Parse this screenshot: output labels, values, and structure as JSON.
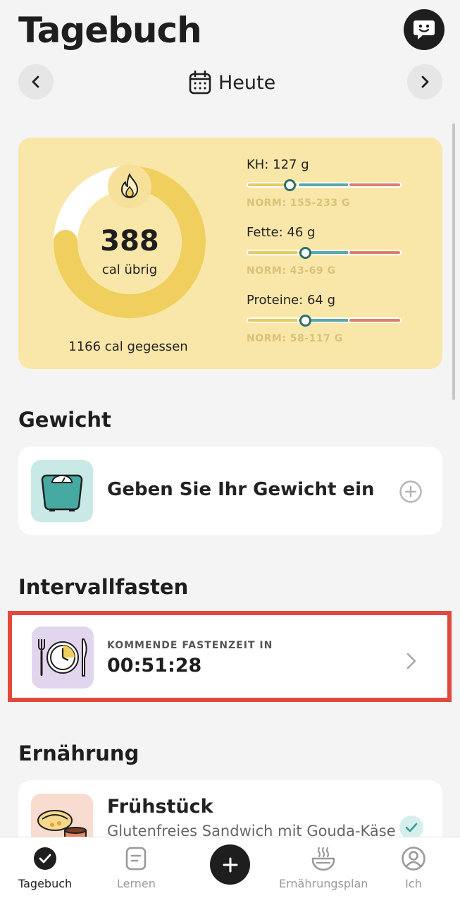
{
  "header": {
    "title": "Tagebuch",
    "date_label": "Heute"
  },
  "summary": {
    "calories_remaining": "388",
    "calories_remaining_label": "cal übrig",
    "calories_eaten": "1166 cal gegessen",
    "progress_fraction": 0.75,
    "macros": [
      {
        "label": "KH: 127 g",
        "norm": "NORM: 155-233 G",
        "marker_fraction": 0.28
      },
      {
        "label": "Fette: 46 g",
        "norm": "NORM: 43-69 G",
        "marker_fraction": 0.38
      },
      {
        "label": "Proteine: 64 g",
        "norm": "NORM: 58-117 G",
        "marker_fraction": 0.38
      }
    ]
  },
  "weight": {
    "section_title": "Gewicht",
    "prompt": "Geben Sie Ihr Gewicht ein"
  },
  "fasting": {
    "section_title": "Intervallfasten",
    "caption": "KOMMENDE FASTENZEIT IN",
    "countdown": "00:51:28"
  },
  "nutrition": {
    "section_title": "Ernährung",
    "meal": {
      "title": "Frühstück",
      "subtitle": "Glutenfreies Sandwich mit Gouda-Käse"
    }
  },
  "bottom_nav": {
    "diary": "Tagebuch",
    "learn": "Lernen",
    "plan": "Ernährungsplan",
    "me": "Ich"
  },
  "colors": {
    "card_yellow": "#f9e7a9",
    "ring_yellow": "#f0cf5e",
    "teal": "#58a9a5",
    "salmon": "#da8069",
    "highlight_red": "#e04a3c"
  }
}
